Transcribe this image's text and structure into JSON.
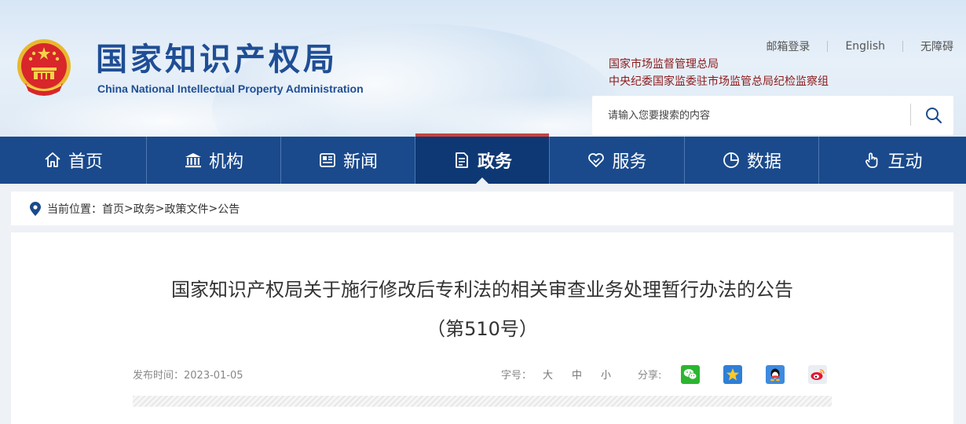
{
  "header": {
    "site_title": "国家知识产权局",
    "site_subtitle": "China National Intellectual Property Administration",
    "top_links": [
      "邮箱登录",
      "English",
      "无障碍"
    ],
    "org_links": [
      "国家市场监督管理总局",
      "中央纪委国家监委驻市场监管总局纪检监察组"
    ],
    "search": {
      "placeholder": "请输入您要搜索的内容",
      "icon": "search-icon"
    }
  },
  "nav": {
    "items": [
      {
        "label": "首页",
        "icon": "home-icon"
      },
      {
        "label": "机构",
        "icon": "institution-icon"
      },
      {
        "label": "新闻",
        "icon": "news-icon"
      },
      {
        "label": "政务",
        "icon": "document-icon",
        "active": true
      },
      {
        "label": "服务",
        "icon": "heart-service-icon"
      },
      {
        "label": "数据",
        "icon": "pie-chart-icon"
      },
      {
        "label": "互动",
        "icon": "hand-pointer-icon"
      }
    ]
  },
  "breadcrumb": {
    "prefix": "当前位置：",
    "items": [
      "首页",
      "政务",
      "政策文件",
      "公告"
    ],
    "separator": ">"
  },
  "article": {
    "title": "国家知识产权局关于施行修改后专利法的相关审查业务处理暂行办法的公告",
    "number": "（第510号）",
    "date_label": "发布时间：2023-01-05",
    "font_label": "字号：",
    "font_sizes": [
      "大",
      "中",
      "小"
    ],
    "share_label": "分享:",
    "share_icons": [
      "wechat-icon",
      "qzone-icon",
      "qq-icon",
      "weibo-icon"
    ]
  },
  "colors": {
    "nav_bg": "#1a4a8c",
    "nav_active_bg": "#0e3874",
    "nav_active_bar": "#c9433f",
    "title_blue": "#1f4e95",
    "org_link": "#8b1a1a"
  }
}
